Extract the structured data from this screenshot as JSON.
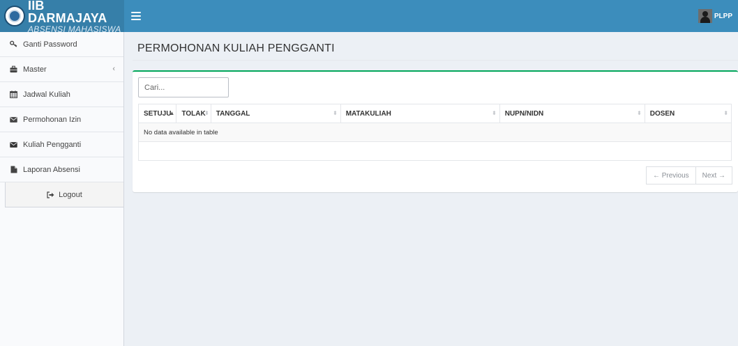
{
  "brand": {
    "title": "IIB DARMAJAYA",
    "subtitle": "ABSENSI MAHASISWA"
  },
  "topbar": {
    "user_name": "PLPP"
  },
  "sidebar": {
    "items": [
      {
        "label": "Ganti Password",
        "icon": "key-icon"
      },
      {
        "label": "Master",
        "icon": "briefcase-icon",
        "caret": "‹"
      },
      {
        "label": "Jadwal Kuliah",
        "icon": "calendar-icon"
      },
      {
        "label": "Permohonan Izin",
        "icon": "envelope-icon"
      },
      {
        "label": "Kuliah Pengganti",
        "icon": "envelope-icon"
      },
      {
        "label": "Laporan Absensi",
        "icon": "file-icon"
      }
    ],
    "logout_label": "Logout"
  },
  "main": {
    "page_title": "PERMOHONAN KULIAH PENGGANTI",
    "search_placeholder": "Cari...",
    "table": {
      "columns": [
        "SETUJU",
        "TOLAK",
        "TANGGAL",
        "MATAKULIAH",
        "NUPN/NIDN",
        "DOSEN"
      ],
      "empty_message": "No data available in table"
    },
    "pagination": {
      "previous_label": "← Previous",
      "next_label": "Next →"
    }
  },
  "colors": {
    "navbar": "#3c8dbc",
    "logo_bg": "#367fa9",
    "box_accent": "#00a65a",
    "content_bg": "#ecf0f5"
  }
}
